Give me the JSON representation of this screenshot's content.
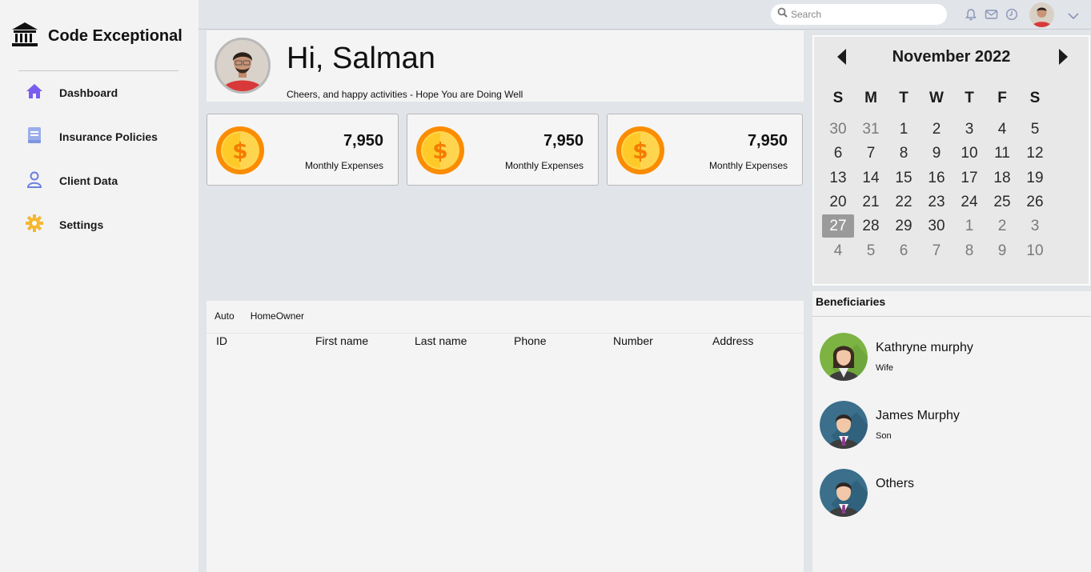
{
  "brand": {
    "title": "Code Exceptional",
    "icon": "bank-icon"
  },
  "sidebar": {
    "items": [
      {
        "label": "Dashboard",
        "icon": "home-icon",
        "color": "#7b5cf0"
      },
      {
        "label": "Insurance Policies",
        "icon": "document-icon",
        "color": "#8fa3e8"
      },
      {
        "label": "Client Data",
        "icon": "user-icon",
        "color": "#6b7fe0"
      },
      {
        "label": "Settings",
        "icon": "gear-icon",
        "color": "#f5b731"
      }
    ]
  },
  "topbar": {
    "search_placeholder": "Search",
    "icons": [
      "bell-icon",
      "mail-icon",
      "clock-icon",
      "avatar",
      "chevron-down-icon"
    ]
  },
  "greeting": {
    "title": "Hi, Salman",
    "subtitle": "Cheers, and happy activities - Hope You are Doing Well"
  },
  "cards": [
    {
      "value": "7,950",
      "label": "Monthly Expenses"
    },
    {
      "value": "7,950",
      "label": "Monthly Expenses"
    },
    {
      "value": "7,950",
      "label": "Monthly Expenses"
    }
  ],
  "table": {
    "tabs": [
      "Auto",
      "HomeOwner"
    ],
    "columns": [
      "ID",
      "First name",
      "Last name",
      "Phone",
      "Number",
      "Address"
    ]
  },
  "calendar": {
    "month_label": "November 2022",
    "weekdays": [
      "S",
      "M",
      "T",
      "W",
      "T",
      "F",
      "S"
    ],
    "weeks": [
      [
        "30",
        "31",
        "1",
        "2",
        "3",
        "4",
        "5"
      ],
      [
        "6",
        "7",
        "8",
        "9",
        "10",
        "11",
        "12"
      ],
      [
        "13",
        "14",
        "15",
        "16",
        "17",
        "18",
        "19"
      ],
      [
        "20",
        "21",
        "22",
        "23",
        "24",
        "25",
        "26"
      ],
      [
        "27",
        "28",
        "29",
        "30",
        "1",
        "2",
        "3"
      ],
      [
        "4",
        "5",
        "6",
        "7",
        "8",
        "9",
        "10"
      ]
    ],
    "selected": "27"
  },
  "beneficiaries": {
    "title": "Beneficiaries",
    "items": [
      {
        "name": "Kathryne murphy",
        "relation": "Wife",
        "bg": "#7cb342"
      },
      {
        "name": "James Murphy",
        "relation": "Son",
        "bg": "#3b6f8c"
      },
      {
        "name": "Others",
        "relation": "",
        "bg": "#3b6f8c"
      }
    ]
  }
}
